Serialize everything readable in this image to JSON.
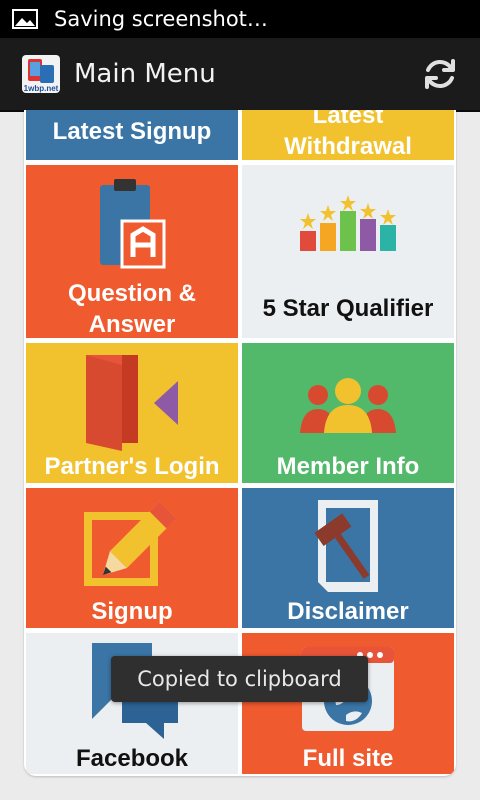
{
  "status_bar": {
    "notification_text": "Saving screenshot…"
  },
  "action_bar": {
    "title": "Main Menu",
    "refresh_icon": "refresh-icon"
  },
  "colors": {
    "blue": "#3a75a6",
    "yellow": "#f2c12e",
    "orange": "#f05a2f",
    "light": "#eceff1",
    "green": "#52b96a"
  },
  "tiles": [
    {
      "label": "Latest Signup",
      "icon": "none"
    },
    {
      "label": "Latest\nWithdrawal",
      "icon": "none"
    },
    {
      "label": "Question &\nAnswer",
      "icon": "clipboard-icon"
    },
    {
      "label": "5 Star Qualifier",
      "icon": "star-bars-icon"
    },
    {
      "label": "Partner's Login",
      "icon": "door-login-icon"
    },
    {
      "label": "Member Info",
      "icon": "members-icon"
    },
    {
      "label": "Signup",
      "icon": "pencil-icon"
    },
    {
      "label": "Disclaimer",
      "icon": "gavel-document-icon"
    },
    {
      "label": "Facebook",
      "icon": "chat-bubbles-icon"
    },
    {
      "label": "Full site",
      "icon": "globe-browser-icon"
    }
  ],
  "toast": {
    "text": "Copied to clipboard"
  }
}
